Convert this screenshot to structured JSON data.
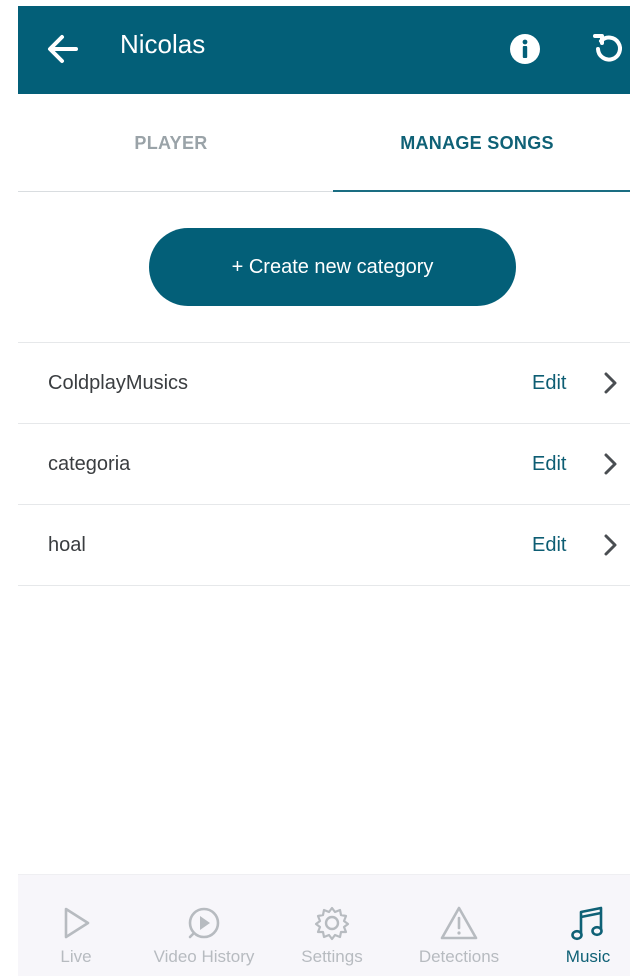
{
  "header": {
    "title": "Nicolas",
    "back_icon": "arrow-left-icon",
    "info_icon": "info-icon",
    "refresh_icon": "refresh-icon",
    "background_color": "#035f78"
  },
  "tabs": [
    {
      "label": "PLAYER",
      "active": false
    },
    {
      "label": "MANAGE SONGS",
      "active": true
    }
  ],
  "create_button": {
    "label": "+ Create new category"
  },
  "categories": [
    {
      "name": "ColdplayMusics",
      "edit_label": "Edit"
    },
    {
      "name": "categoria",
      "edit_label": "Edit"
    },
    {
      "name": "hoal",
      "edit_label": "Edit"
    }
  ],
  "bottom_nav": [
    {
      "label": "Live",
      "icon": "play-icon",
      "active": false
    },
    {
      "label": "Video History",
      "icon": "video-history-icon",
      "active": false
    },
    {
      "label": "Settings",
      "icon": "gear-icon",
      "active": false
    },
    {
      "label": "Detections",
      "icon": "warning-icon",
      "active": false
    },
    {
      "label": "Music",
      "icon": "music-note-icon",
      "active": true
    }
  ],
  "colors": {
    "accent": "#035f78",
    "active_text": "#0f6176",
    "inactive_text": "#b7bbc0"
  }
}
